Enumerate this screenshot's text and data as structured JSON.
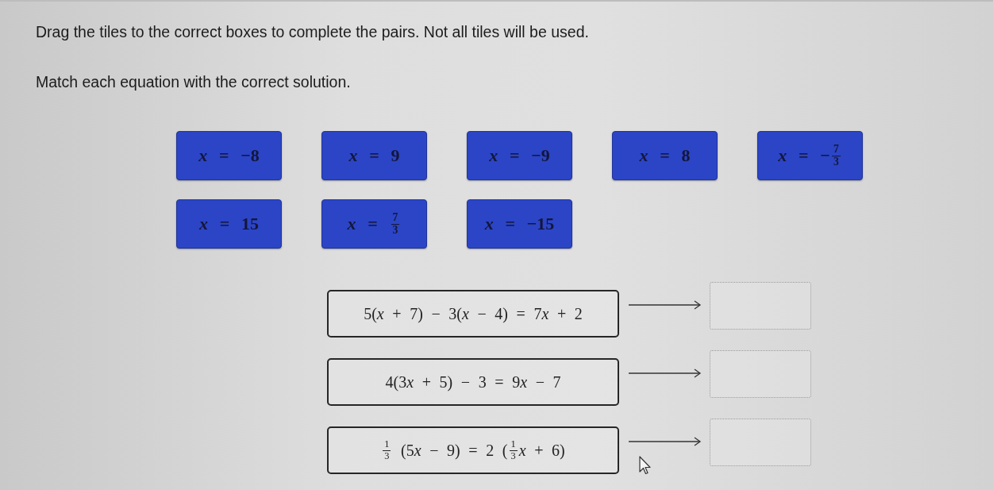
{
  "instructions": [
    "Drag the tiles to the correct boxes to complete the pairs. Not all tiles will be used.",
    "Match each equation with the correct solution."
  ],
  "tiles": [
    {
      "math": [
        {
          "kind": "text",
          "text": "*x* = −8"
        }
      ]
    },
    {
      "math": [
        {
          "kind": "text",
          "text": "*x* = 9"
        }
      ]
    },
    {
      "math": [
        {
          "kind": "text",
          "text": "*x* = −9"
        }
      ]
    },
    {
      "math": [
        {
          "kind": "text",
          "text": "*x* = 8"
        }
      ]
    },
    {
      "math": [
        {
          "kind": "text",
          "text": "*x* = −"
        },
        {
          "kind": "fraction",
          "numerator": "7",
          "denominator": "3"
        }
      ]
    },
    {
      "math": [
        {
          "kind": "text",
          "text": "*x* = 15"
        }
      ]
    },
    {
      "math": [
        {
          "kind": "text",
          "text": "*x* = "
        },
        {
          "kind": "fraction",
          "numerator": "7",
          "denominator": "3"
        }
      ]
    },
    {
      "math": [
        {
          "kind": "text",
          "text": "*x* = −15"
        }
      ]
    }
  ],
  "pairs": [
    {
      "equation": [
        {
          "kind": "text",
          "text": "5(*x* + 7) − 3(*x* − 4) = 7"
        },
        {
          "kind": "text",
          "text": "*x* + 2"
        }
      ]
    },
    {
      "equation": [
        {
          "kind": "text",
          "text": "4(3"
        },
        {
          "kind": "text",
          "text": "*x* + 5) − 3 = 9"
        },
        {
          "kind": "text",
          "text": "*x* − 7"
        }
      ]
    },
    {
      "equation": [
        {
          "kind": "fraction",
          "numerator": "1",
          "denominator": "3"
        },
        {
          "kind": "text",
          "text": " (5"
        },
        {
          "kind": "text",
          "text": "*x* − 9) = 2 ("
        },
        {
          "kind": "fraction",
          "numerator": "1",
          "denominator": "3"
        },
        {
          "kind": "text",
          "text": "*x* + 6)"
        }
      ]
    }
  ]
}
